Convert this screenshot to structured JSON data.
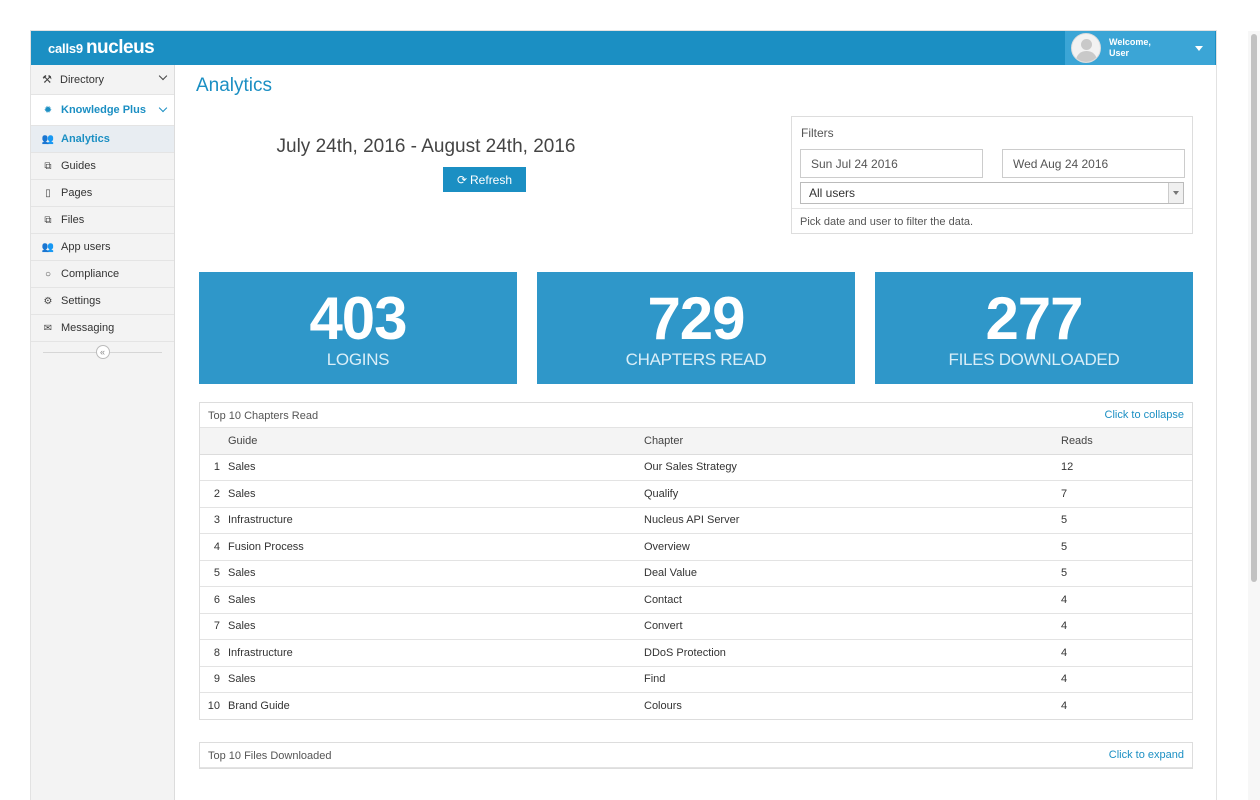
{
  "header": {
    "logo_calls": "calls9",
    "logo_nucleus": "nucleus",
    "welcome_line1": "Welcome,",
    "welcome_line2": "User"
  },
  "sidebar": {
    "directory": "Directory",
    "section": "Knowledge Plus",
    "items": [
      {
        "label": "Analytics",
        "icon": "users-icon",
        "glyph": "👥",
        "active": true
      },
      {
        "label": "Guides",
        "icon": "copy-icon",
        "glyph": "⧉",
        "active": false
      },
      {
        "label": "Pages",
        "icon": "page-icon",
        "glyph": "▯",
        "active": false
      },
      {
        "label": "Files",
        "icon": "copy-icon",
        "glyph": "⧉",
        "active": false
      },
      {
        "label": "App users",
        "icon": "users-icon",
        "glyph": "👥",
        "active": false
      },
      {
        "label": "Compliance",
        "icon": "circle-icon",
        "glyph": "○",
        "active": false
      },
      {
        "label": "Settings",
        "icon": "gear-icon",
        "glyph": "⚙",
        "active": false
      },
      {
        "label": "Messaging",
        "icon": "envelope-icon",
        "glyph": "✉",
        "active": false
      }
    ],
    "collapse_glyph": "«"
  },
  "main": {
    "title": "Analytics",
    "date_range": "July 24th, 2016 - August 24th, 2016",
    "refresh_label": "Refresh"
  },
  "filters": {
    "title": "Filters",
    "start_date": "Sun Jul 24 2016",
    "end_date": "Wed Aug 24 2016",
    "user_select": "All users",
    "hint": "Pick date and user to filter the data."
  },
  "stats": [
    {
      "value": "403",
      "label": "LOGINS"
    },
    {
      "value": "729",
      "label": "CHAPTERS READ"
    },
    {
      "value": "277",
      "label": "FILES DOWNLOADED"
    }
  ],
  "chapters_table": {
    "title": "Top 10 Chapters Read",
    "toggle": "Click to collapse",
    "columns": [
      "Guide",
      "Chapter",
      "Reads"
    ],
    "rows": [
      [
        "1",
        "Sales",
        "Our Sales Strategy",
        "12"
      ],
      [
        "2",
        "Sales",
        "Qualify",
        "7"
      ],
      [
        "3",
        "Infrastructure",
        "Nucleus API Server",
        "5"
      ],
      [
        "4",
        "Fusion Process",
        "Overview",
        "5"
      ],
      [
        "5",
        "Sales",
        "Deal Value",
        "5"
      ],
      [
        "6",
        "Sales",
        "Contact",
        "4"
      ],
      [
        "7",
        "Sales",
        "Convert",
        "4"
      ],
      [
        "8",
        "Infrastructure",
        "DDoS Protection",
        "4"
      ],
      [
        "9",
        "Sales",
        "Find",
        "4"
      ],
      [
        "10",
        "Brand Guide",
        "Colours",
        "4"
      ]
    ]
  },
  "files_table": {
    "title": "Top 10 Files Downloaded",
    "toggle": "Click to expand"
  },
  "colors": {
    "brand": "#1b8fc3",
    "stat_card": "#2f97c9"
  }
}
